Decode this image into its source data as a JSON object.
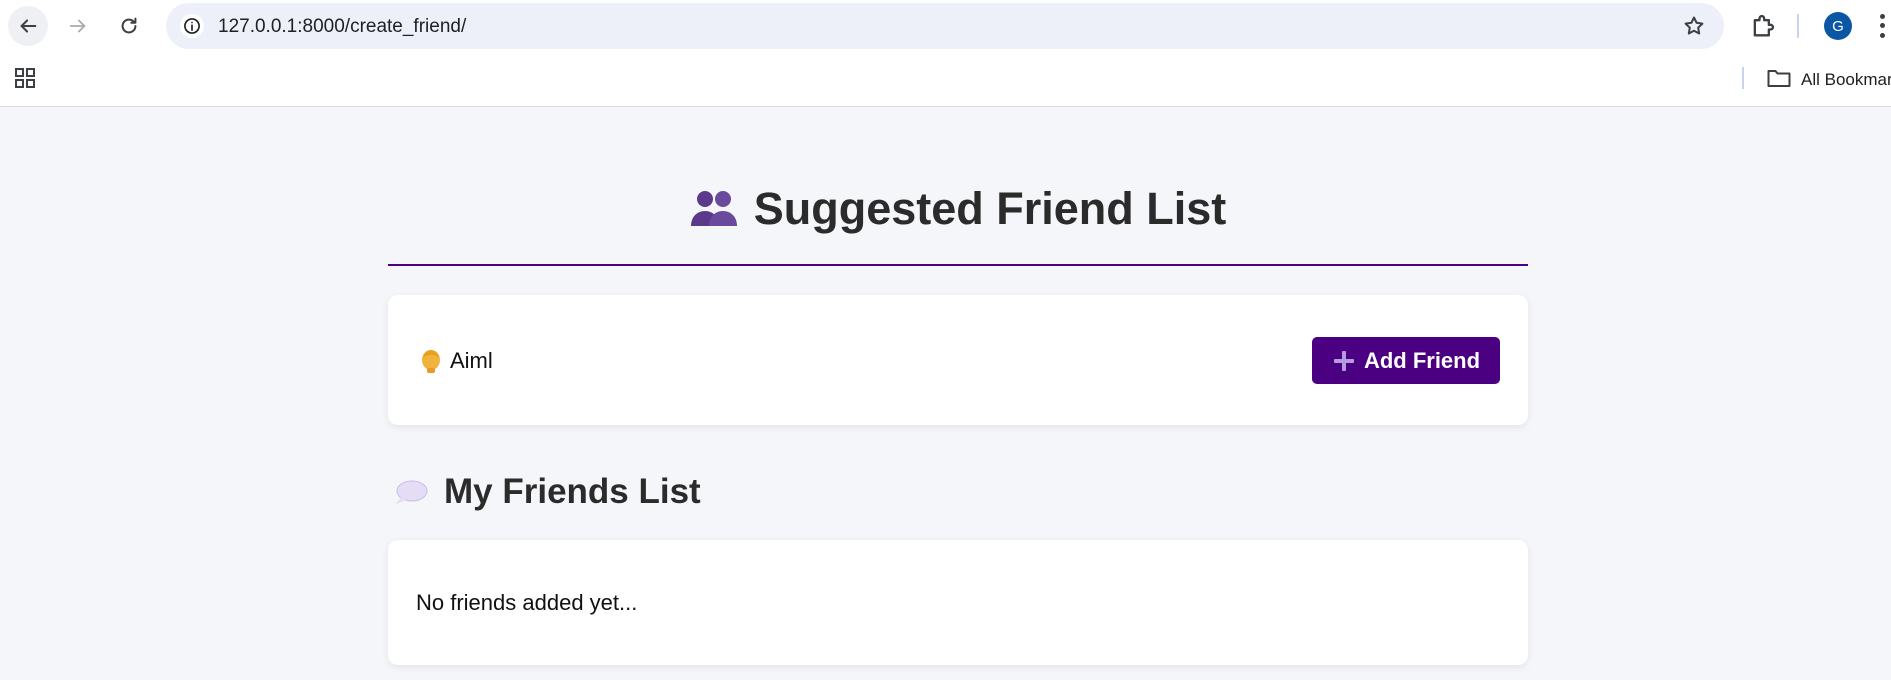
{
  "browser": {
    "url": "127.0.0.1:8000/create_friend/",
    "profile_initial": "G",
    "bookmarks_label": "All Bookmarks",
    "icons": {
      "back": "arrow-left-icon",
      "forward": "arrow-right-icon",
      "reload": "reload-icon",
      "site_info": "info-icon",
      "bookmark_star": "star-icon",
      "extensions": "puzzle-icon",
      "menu": "kebab-menu-icon",
      "apps": "apps-grid-icon",
      "folder": "folder-icon"
    }
  },
  "page": {
    "title": "Suggested Friend List",
    "title_icon": "two-people-icon",
    "suggested": [
      {
        "name": "Aiml",
        "icon": "person-icon",
        "button_label": "Add Friend",
        "button_icon": "plus-icon"
      }
    ],
    "friends_section": {
      "title": "My Friends List",
      "icon": "speech-bubble-icon",
      "empty_text": "No friends added yet..."
    }
  },
  "colors": {
    "accent": "#4b0082",
    "page_bg": "#f5f6fa",
    "card_bg": "#ffffff",
    "text": "#2b2b2b",
    "avatar": "#0b57a3"
  }
}
